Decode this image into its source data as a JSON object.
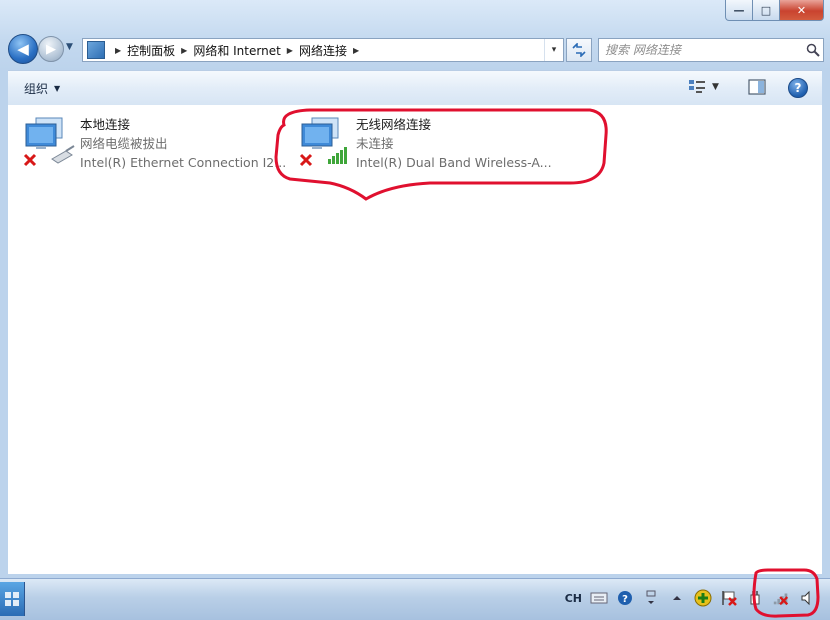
{
  "window": {
    "minimize_glyph": "—",
    "maximize_glyph": "□",
    "close_glyph": "✕"
  },
  "address_bar": {
    "crumbs": [
      "控制面板",
      "网络和 Internet",
      "网络连接"
    ],
    "dropdown_glyph": "▾"
  },
  "search": {
    "placeholder": "搜索 网络连接"
  },
  "command_bar": {
    "organize_label": "组织",
    "organize_caret": "▼",
    "help_glyph": "?"
  },
  "connections": [
    {
      "name": "本地连接",
      "status": "网络电缆被拔出",
      "device": "Intel(R) Ethernet Connection I2..."
    },
    {
      "name": "无线网络连接",
      "status": "未连接",
      "device": "Intel(R) Dual Band Wireless-A..."
    }
  ],
  "taskbar": {
    "language": "CH"
  },
  "colors": {
    "annotation_red": "#e0102f",
    "error_red": "#d81818",
    "signal_green": "#3fa63a"
  }
}
